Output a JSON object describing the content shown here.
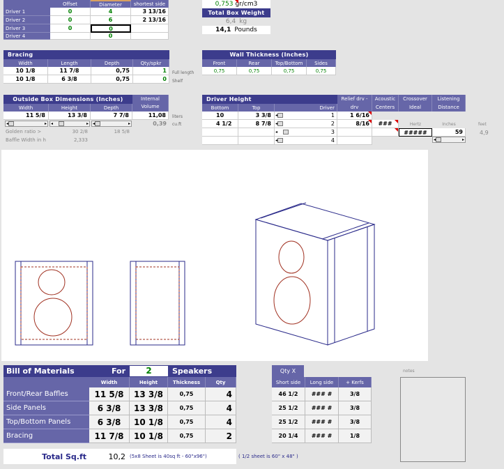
{
  "drivers_table": {
    "headers": [
      "Offset",
      "Diameter",
      "shortest side"
    ],
    "rows": [
      {
        "label": "Driver 1",
        "offset": "0",
        "diameter": "4",
        "shortest": "3 13/16"
      },
      {
        "label": "Driver 2",
        "offset": "0",
        "diameter": "6",
        "shortest": "2 13/16"
      },
      {
        "label": "Driver 3",
        "offset": "0",
        "diameter": "0",
        "shortest": ""
      },
      {
        "label": "Driver 4",
        "offset": "",
        "diameter": "0",
        "shortest": ""
      }
    ]
  },
  "density": {
    "value": "0,753",
    "unit": "gr/cm3"
  },
  "box_weight": {
    "title": "Total Box Weight",
    "kg_value": "6,4",
    "kg_unit": "kg",
    "lb_value": "14,1",
    "lb_unit": "Pounds"
  },
  "bracing": {
    "title": "Bracing",
    "headers": [
      "Width",
      "Length",
      "Depth",
      "Qty/spkr"
    ],
    "rows": [
      {
        "width": "10  1/8",
        "length": "11  7/8",
        "depth": "0,75",
        "qty": "1",
        "note": "Full length"
      },
      {
        "width": "10  1/8",
        "length": "6  3/8",
        "depth": "0,75",
        "qty": "0",
        "note": "Shelf"
      }
    ]
  },
  "wall_thickness": {
    "title": "Wall Thickness (Inches)",
    "headers": [
      "Front",
      "Rear",
      "Top/Bottom",
      "Sides"
    ],
    "values": [
      "0,75",
      "0,75",
      "0,75",
      "0,75"
    ]
  },
  "outside_dims": {
    "title": "Outside Box Dimensions (Inches)",
    "headers": [
      "Width",
      "Height",
      "Depth"
    ],
    "values": [
      "11 5/8",
      "13 3/8",
      "7 7/8"
    ],
    "internal_title": "Internal Volume",
    "liters": "11,08",
    "liters_unit": "liters",
    "cuft": "0,39",
    "cuft_unit": "cu.ft",
    "golden_label": "Golden ratio >",
    "golden_a": "30 2/8",
    "golden_b": "18 5/8",
    "baffle_label": "Baffle Width in h",
    "baffle_value": "2,333"
  },
  "driver_height": {
    "title": "Driver Height",
    "headers": [
      "Bottom",
      "Top",
      "Driver"
    ],
    "rows": [
      {
        "bottom": "10",
        "top": "3 3/8",
        "driver": "1"
      },
      {
        "bottom": "4  1/2",
        "top": "8 7/8",
        "driver": "2"
      },
      {
        "bottom": "",
        "top": "",
        "driver": "3"
      },
      {
        "bottom": "",
        "top": "",
        "driver": "4"
      }
    ]
  },
  "relief": {
    "headers": [
      "Relief drv - drv",
      "Acoustic Centers",
      "Crossover Ideal",
      "Listening Distance"
    ],
    "rows": [
      "1  6/16",
      "8/16",
      "",
      ""
    ],
    "acoustic": "###",
    "crossover": "#####",
    "hertz_label": "Hertz",
    "inches_label": "Inches",
    "feet_label": "feet",
    "inches_value": "59",
    "feet_value": "4,9"
  },
  "bom": {
    "title": "Bill of Materials",
    "for_label": "For",
    "for_value": "2",
    "speakers_label": "Speakers",
    "headers": [
      "Width",
      "Height",
      "Thickness",
      "Qty"
    ],
    "rows": [
      {
        "label": "Front/Rear Baffles",
        "width": "11 5/8",
        "height": "13 3/8",
        "thick": "0,75",
        "qty": "4"
      },
      {
        "label": "Side Panels",
        "width": "6 3/8",
        "height": "13 3/8",
        "thick": "0,75",
        "qty": "4"
      },
      {
        "label": "Top/Bottom Panels",
        "width": "6 3/8",
        "height": "10 1/8",
        "thick": "0,75",
        "qty": "4"
      },
      {
        "label": "Bracing",
        "width": "11 7/8",
        "height": "10 1/8",
        "thick": "0,75",
        "qty": "2"
      }
    ],
    "total_label": "Total Sq.ft",
    "total_value": "10,2",
    "sheet_note": "(5x8 Sheet is 40sq ft - 60\"x96\")",
    "half_sheet_note": "( 1/2 sheet is 60\" x 48\" )"
  },
  "qty_table": {
    "title": "Qty X",
    "headers": [
      "Short side",
      "Long side",
      "+ Kerfs"
    ],
    "rows": [
      {
        "short": "46  1/2",
        "long": "### #",
        "kerf": "3/8"
      },
      {
        "short": "25  1/2",
        "long": "### #",
        "kerf": "3/8"
      },
      {
        "short": "25  1/2",
        "long": "### #",
        "kerf": "3/8"
      },
      {
        "short": "20  1/4",
        "long": "### #",
        "kerf": "1/8"
      }
    ]
  },
  "notes": {
    "label": "notes"
  },
  "colors": {
    "header_bg": "#3c3c8c",
    "subheader_bg": "#6666a8",
    "value_green": "#008000",
    "drawing_blue": "#2a2a8a",
    "driver_red": "#a03020"
  }
}
